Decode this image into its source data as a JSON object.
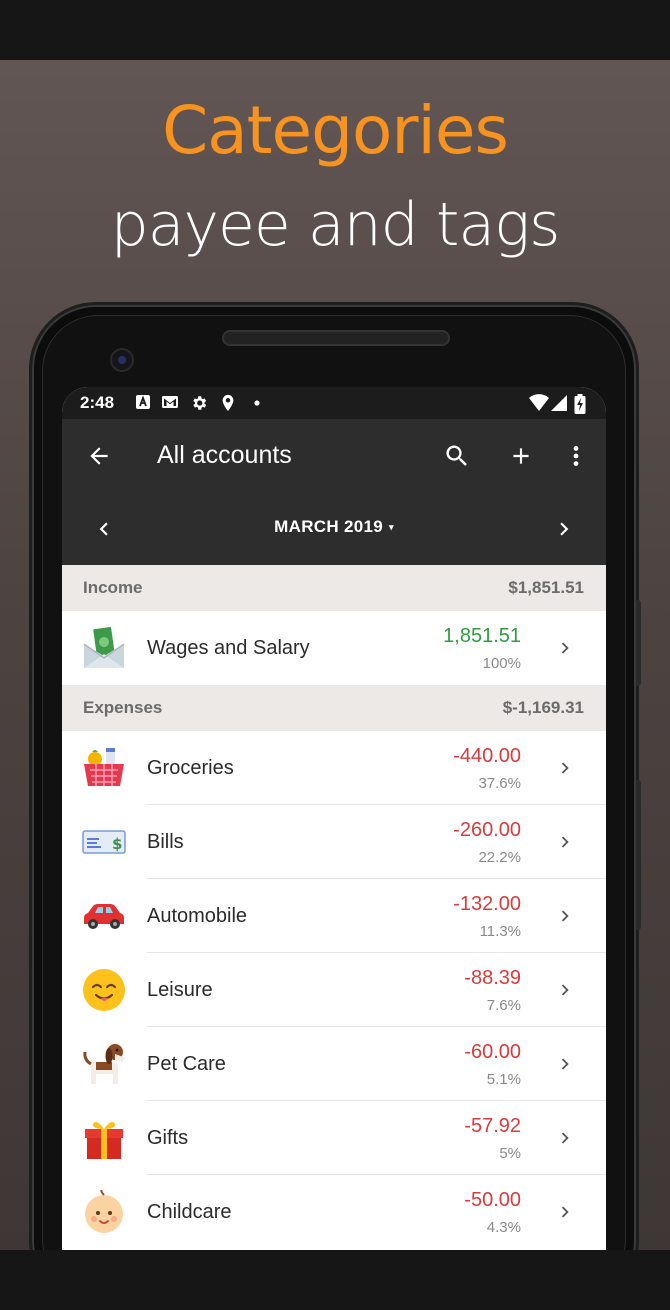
{
  "promo": {
    "headline": "Categories",
    "subline": "payee and tags",
    "headline_color": "#f7931e"
  },
  "status_bar": {
    "time": "2:48",
    "icons": [
      "a-notification-icon",
      "gmail-icon",
      "settings-icon",
      "location-icon",
      "dot-icon",
      "wifi-icon",
      "signal-icon",
      "battery-charging-icon"
    ]
  },
  "app_bar": {
    "back_icon": "arrow-left-icon",
    "title": "All accounts",
    "actions": [
      "search-icon",
      "add-icon",
      "more-vert-icon"
    ]
  },
  "month_nav": {
    "label": "MARCH 2019",
    "caret": "▾",
    "prev_icon": "chevron-left-icon",
    "next_icon": "chevron-right-icon"
  },
  "income": {
    "header": "Income",
    "total": "$1,851.51",
    "rows": [
      {
        "icon": "money-envelope-icon",
        "name": "Wages and Salary",
        "amount": "1,851.51",
        "percent": "100%"
      }
    ]
  },
  "expenses": {
    "header": "Expenses",
    "total": "$-1,169.31",
    "rows": [
      {
        "icon": "grocery-basket-icon",
        "name": "Groceries",
        "amount": "-440.00",
        "percent": "37.6%"
      },
      {
        "icon": "check-bill-icon",
        "name": "Bills",
        "amount": "-260.00",
        "percent": "22.2%"
      },
      {
        "icon": "car-icon",
        "name": "Automobile",
        "amount": "-132.00",
        "percent": "11.3%"
      },
      {
        "icon": "smiling-face-icon",
        "name": "Leisure",
        "amount": "-88.39",
        "percent": "7.6%"
      },
      {
        "icon": "dog-icon",
        "name": "Pet Care",
        "amount": "-60.00",
        "percent": "5.1%"
      },
      {
        "icon": "gift-icon",
        "name": "Gifts",
        "amount": "-57.92",
        "percent": "5%"
      },
      {
        "icon": "baby-icon",
        "name": "Childcare",
        "amount": "-50.00",
        "percent": "4.3%"
      }
    ]
  },
  "colors": {
    "positive": "#2e9e3e",
    "negative": "#d83c3c",
    "toolbar": "#2d2d2d",
    "section_header": "#ece9e6"
  }
}
